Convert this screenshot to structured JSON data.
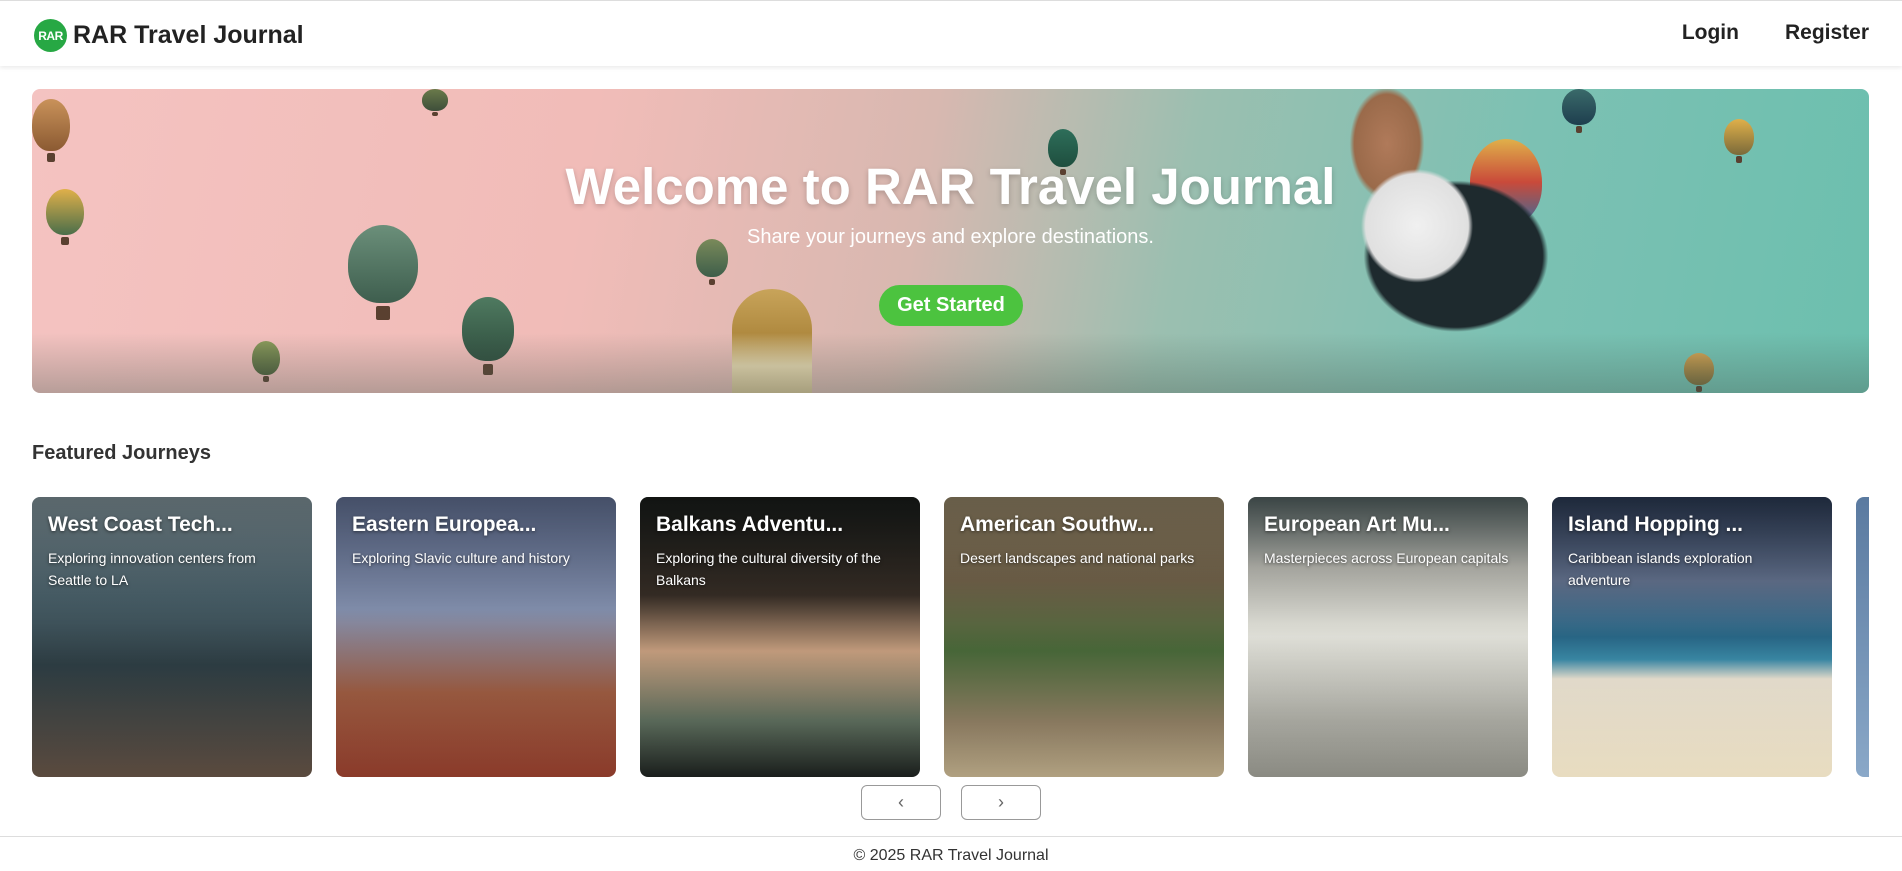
{
  "navbar": {
    "logo_text": "RAR",
    "title": "RAR Travel Journal",
    "links": {
      "login": "Login",
      "register": "Register"
    }
  },
  "hero": {
    "title": "Welcome to RAR Travel Journal",
    "subtitle": "Share your journeys and explore destinations.",
    "cta": "Get Started"
  },
  "featured": {
    "heading": "Featured Journeys",
    "cards": [
      {
        "title": "West Coast Tech...",
        "description": "Exploring innovation centers from Seattle to LA"
      },
      {
        "title": "Eastern Europea...",
        "description": "Exploring Slavic culture and history"
      },
      {
        "title": "Balkans Adventu...",
        "description": "Exploring the cultural diversity of the Balkans"
      },
      {
        "title": "American Southw...",
        "description": "Desert landscapes and national parks"
      },
      {
        "title": "European Art Mu...",
        "description": "Masterpieces across European capitals"
      },
      {
        "title": "Island Hopping ...",
        "description": "Caribbean islands exploration adventure"
      }
    ],
    "prev_label": "‹",
    "next_label": "›"
  },
  "footer": {
    "text": "© 2025 RAR Travel Journal"
  },
  "colors": {
    "accent": "#4cc33f",
    "logo": "#27a844"
  }
}
